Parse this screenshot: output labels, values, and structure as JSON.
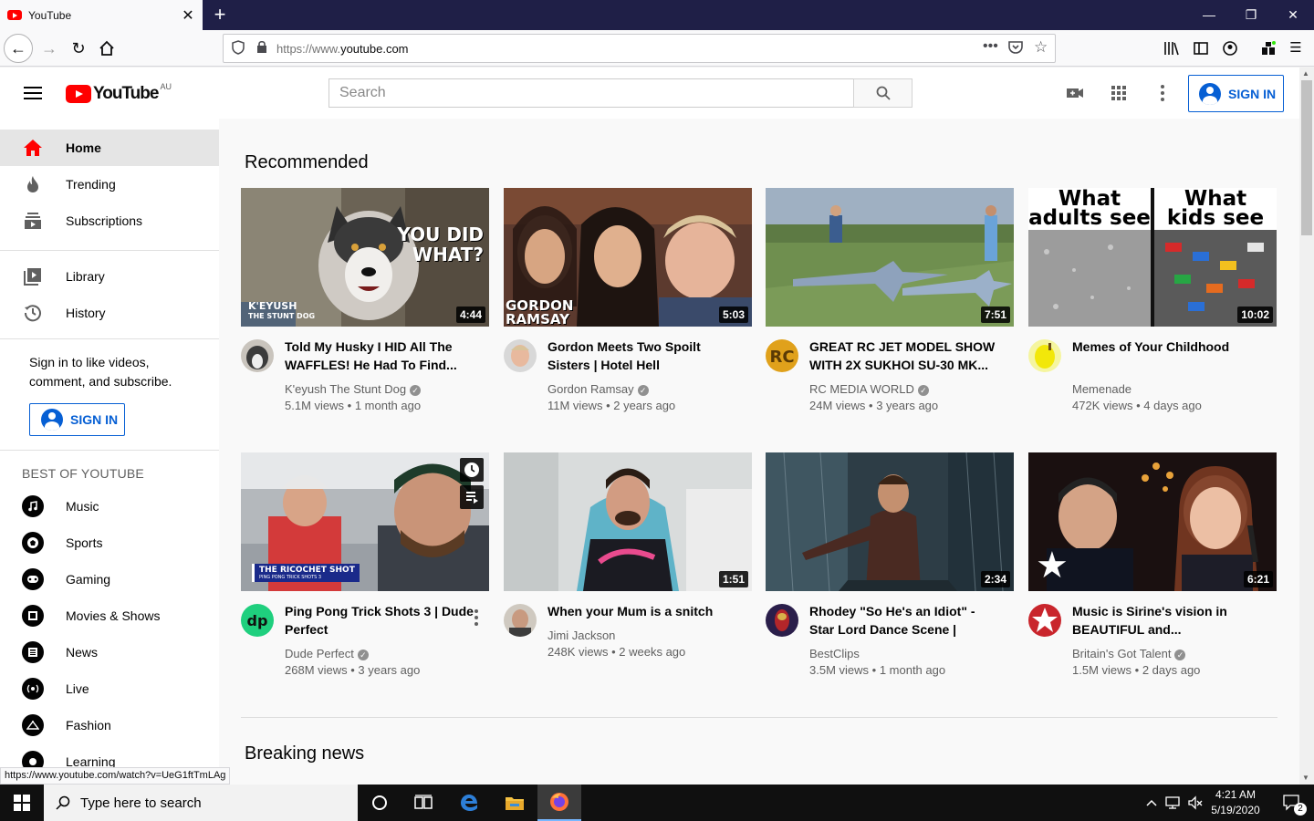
{
  "browser": {
    "tab_title": "YouTube",
    "url_prefix": "https://www.",
    "url_domain": "youtube.com",
    "status_url": "https://www.youtube.com/watch?v=UeG1ftTmLAg"
  },
  "header": {
    "logo_text": "YouTube",
    "country_code": "AU",
    "search_placeholder": "Search",
    "sign_in_label": "SIGN IN"
  },
  "sidebar": {
    "main_items": [
      {
        "label": "Home",
        "icon": "home-icon"
      },
      {
        "label": "Trending",
        "icon": "flame-icon"
      },
      {
        "label": "Subscriptions",
        "icon": "subscriptions-icon"
      }
    ],
    "library_items": [
      {
        "label": "Library",
        "icon": "library-icon"
      },
      {
        "label": "History",
        "icon": "history-icon"
      }
    ],
    "sign_in_prompt": "Sign in to like videos, comment, and subscribe.",
    "sign_in_label": "SIGN IN",
    "best_heading": "BEST OF YOUTUBE",
    "best_items": [
      {
        "label": "Music",
        "icon": "music-icon"
      },
      {
        "label": "Sports",
        "icon": "sports-icon"
      },
      {
        "label": "Gaming",
        "icon": "gaming-icon"
      },
      {
        "label": "Movies & Shows",
        "icon": "movies-icon"
      },
      {
        "label": "News",
        "icon": "news-icon"
      },
      {
        "label": "Live",
        "icon": "live-icon"
      },
      {
        "label": "Fashion",
        "icon": "fashion-icon"
      },
      {
        "label": "Learning",
        "icon": "learning-icon"
      }
    ]
  },
  "main": {
    "recommended_title": "Recommended",
    "breaking_title": "Breaking news",
    "videos": [
      {
        "title": "Told My Husky I HID All The WAFFLES! He Had To Find...",
        "channel": "K'eyush The Stunt Dog",
        "verified": true,
        "views": "5.1M views",
        "age": "1 month ago",
        "duration": "4:44",
        "overlay": [
          "YOU DID",
          "WHAT?"
        ],
        "corner": [
          "K'EYUSH",
          "THE STUNT DOG"
        ]
      },
      {
        "title": "Gordon Meets Two Spoilt Sisters | Hotel Hell",
        "channel": "Gordon Ramsay",
        "verified": true,
        "views": "11M views",
        "age": "2 years ago",
        "duration": "5:03",
        "corner": [
          "GORDON",
          "RAMSAY"
        ]
      },
      {
        "title": "GREAT RC JET MODEL SHOW WITH 2X SUKHOI SU-30 MK...",
        "channel": "RC MEDIA WORLD",
        "verified": true,
        "views": "24M views",
        "age": "3 years ago",
        "duration": "7:51"
      },
      {
        "title": "Memes of Your Childhood",
        "channel": "Memenade",
        "verified": false,
        "views": "472K views",
        "age": "4 days ago",
        "duration": "10:02",
        "caption_left": [
          "What",
          "adults see"
        ],
        "caption_right": [
          "What",
          "kids see"
        ]
      },
      {
        "title": "Ping Pong Trick Shots 3 | Dude Perfect",
        "channel": "Dude Perfect",
        "verified": true,
        "views": "268M views",
        "age": "3 years ago",
        "duration": "",
        "banner": "THE RICOCHET SHOT",
        "banner_sub": "PING PONG TRICK SHOTS 3"
      },
      {
        "title": "When your Mum is a snitch",
        "channel": "Jimi Jackson",
        "verified": false,
        "views": "248K views",
        "age": "2 weeks ago",
        "duration": "1:51"
      },
      {
        "title": "Rhodey \"So He's an Idiot\" - Star Lord Dance Scene | AVENGER...",
        "channel": "BestClips",
        "verified": false,
        "views": "3.5M views",
        "age": "1 month ago",
        "duration": "2:34"
      },
      {
        "title": "Music is Sirine's vision in BEAUTIFUL and...",
        "channel": "Britain's Got Talent",
        "verified": true,
        "views": "1.5M views",
        "age": "2 days ago",
        "duration": "6:21"
      }
    ]
  },
  "taskbar": {
    "search_placeholder": "Type here to search",
    "time": "4:21 AM",
    "date": "5/19/2020",
    "notification_count": "2"
  },
  "colors": {
    "yt_red": "#ff0000",
    "link_blue": "#065fd4",
    "browser_frame": "#1f1f47"
  }
}
